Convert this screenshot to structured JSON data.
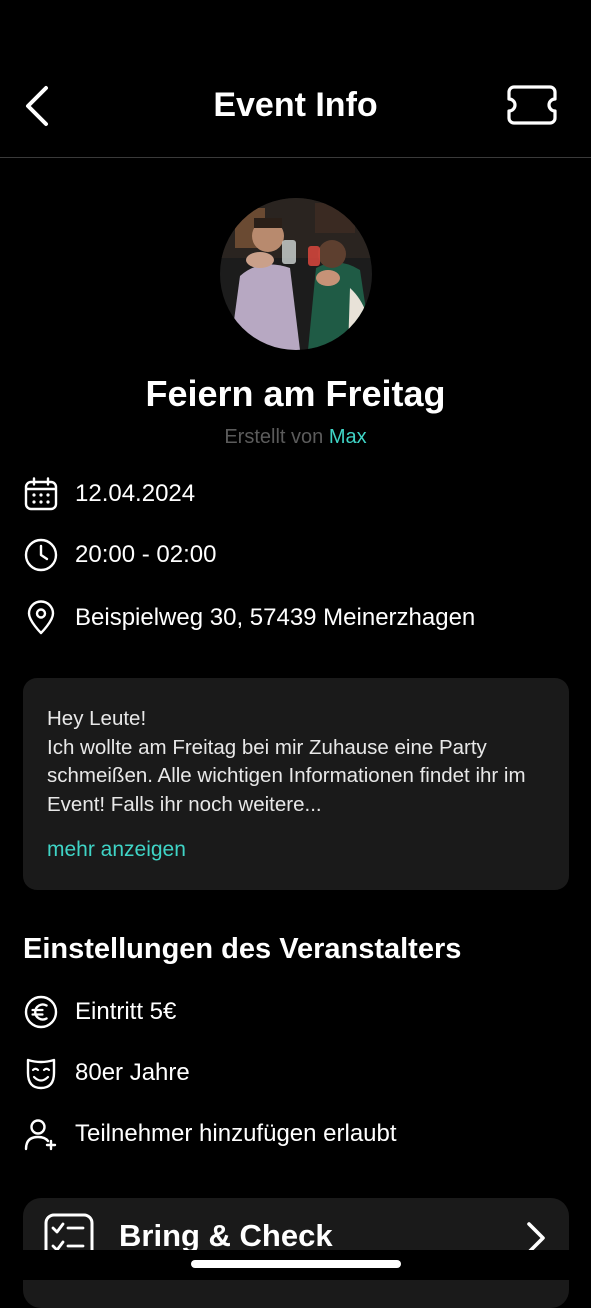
{
  "header": {
    "title": "Event Info",
    "back_icon": "chevron-left-icon",
    "ticket_icon": "ticket-icon"
  },
  "event": {
    "name": "Feiern am Freitag",
    "created_by_prefix": "Erstellt von",
    "host": "Max",
    "date": "12.04.2024",
    "time": "20:00 - 02:00",
    "address": "Beispielweg 30, 57439 Meinerzhagen"
  },
  "description": {
    "text": "Hey Leute!\nIch wollte am Freitag bei mir Zuhause eine Party schmeißen. Alle wichtigen Informationen findet ihr im Event! Falls ihr noch weitere...",
    "more_label": "mehr anzeigen"
  },
  "settings": {
    "title": "Einstellungen des Veranstalters",
    "items": [
      {
        "icon": "euro-icon",
        "label": "Eintritt 5€"
      },
      {
        "icon": "mask-icon",
        "label": "80er Jahre"
      },
      {
        "icon": "add-user-icon",
        "label": "Teilnehmer hinzufügen erlaubt"
      }
    ]
  },
  "bring_check": {
    "label": "Bring & Check",
    "icon": "checklist-icon"
  },
  "colors": {
    "accent": "#3fd4c6",
    "background": "#000000",
    "card": "#1a1a1a",
    "muted": "#5b5b5b"
  }
}
